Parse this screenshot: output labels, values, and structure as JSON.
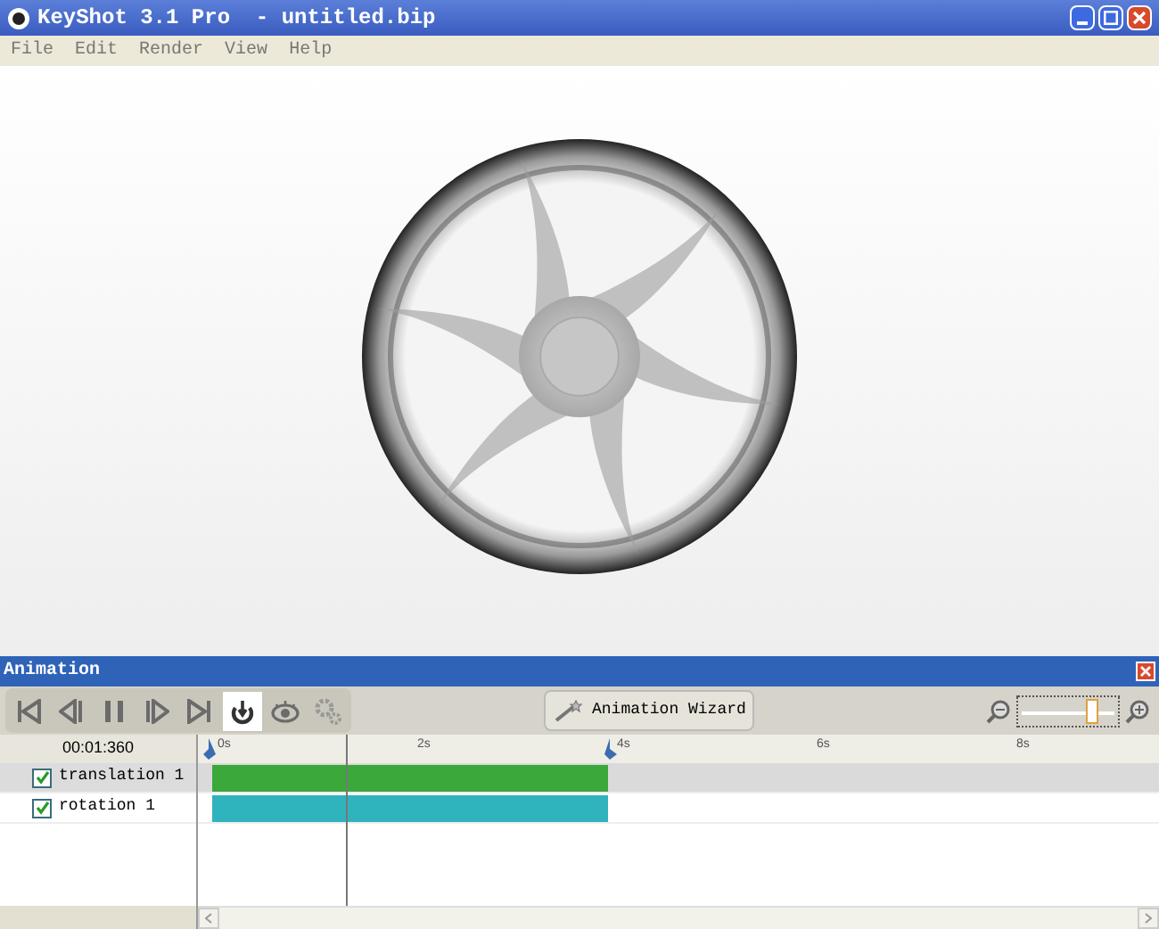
{
  "window": {
    "title": "KeyShot 3.1 Pro  - untitled.bip"
  },
  "menu": [
    "File",
    "Edit",
    "Render",
    "View",
    "Help"
  ],
  "animation_panel": {
    "title": "Animation",
    "transport": [
      {
        "kind": "first"
      },
      {
        "kind": "prev"
      },
      {
        "kind": "pause"
      },
      {
        "kind": "next"
      },
      {
        "kind": "last"
      },
      {
        "kind": "loop",
        "selected": true
      },
      {
        "kind": "preview",
        "selected": false
      },
      {
        "kind": "settings",
        "selected": false
      }
    ],
    "wizard_button": "Animation Wizard",
    "zoom_slider": {
      "level": 0.8
    },
    "time": "00:01:360",
    "ruler": [
      "0s",
      "2s",
      "4s",
      "6s",
      "8s"
    ],
    "tracks": [
      {
        "name": "translation 1",
        "checked": true,
        "selected": true,
        "color": "#3aa83a"
      },
      {
        "name": "rotation 1",
        "checked": true,
        "selected": false,
        "color": "#2fb3bd"
      }
    ]
  }
}
